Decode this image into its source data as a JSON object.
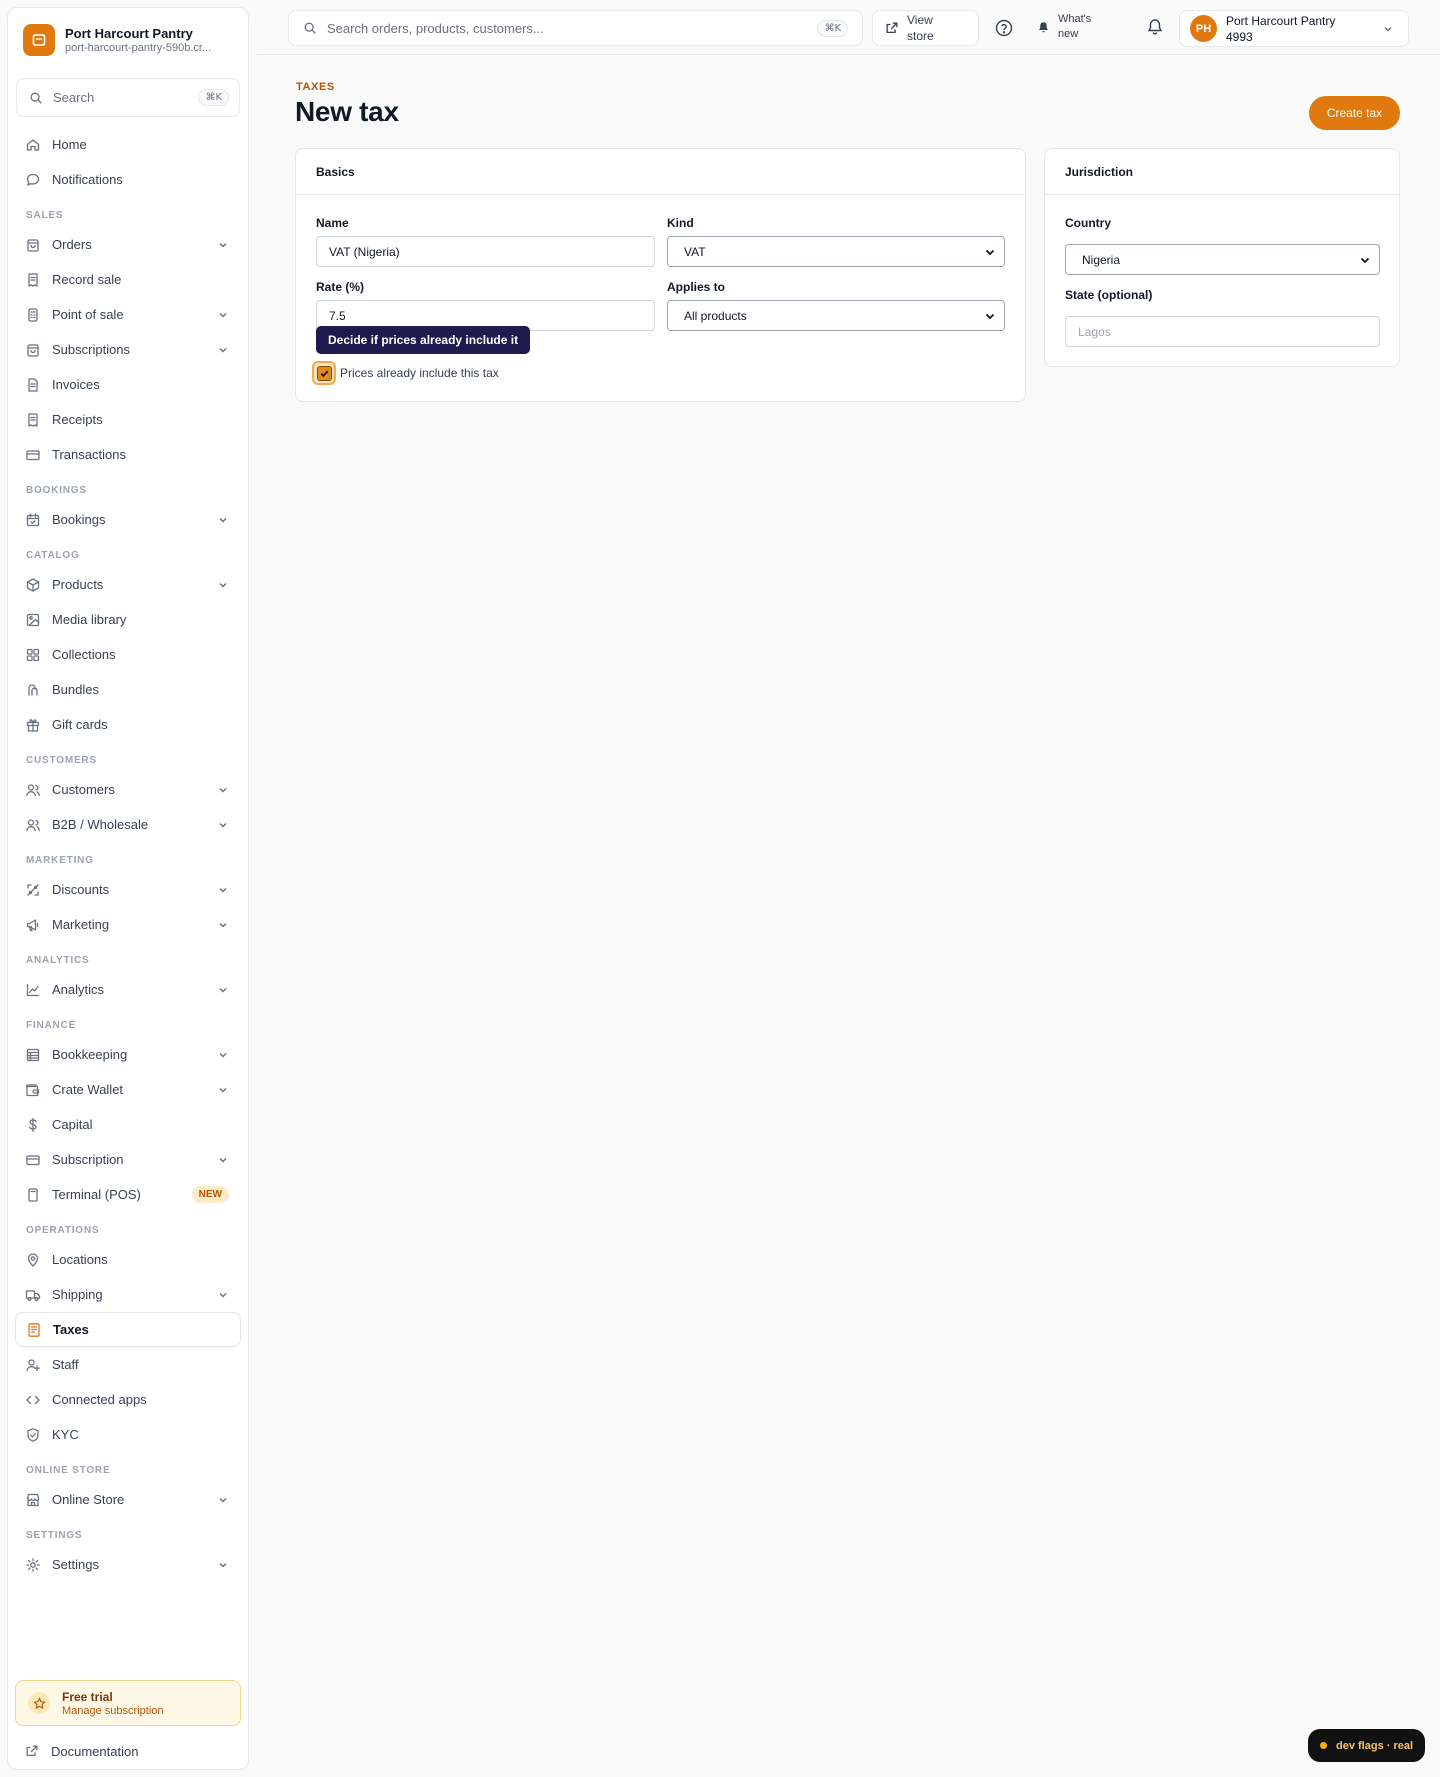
{
  "brand": {
    "name": "Port Harcourt Pantry",
    "domain": "port-harcourt-pantry-590b.cr..."
  },
  "sidebar_search": {
    "label": "Search",
    "shortcut": "⌘K"
  },
  "nav": {
    "top": [
      {
        "label": "Home",
        "icon": "home-icon"
      },
      {
        "label": "Notifications",
        "icon": "chat-bubble-icon"
      }
    ],
    "sales_label": "SALES",
    "sales": [
      {
        "label": "Orders",
        "icon": "bag-icon",
        "chevron": true
      },
      {
        "label": "Record sale",
        "icon": "receipt-icon"
      },
      {
        "label": "Point of sale",
        "icon": "pos-icon",
        "chevron": true
      },
      {
        "label": "Subscriptions",
        "icon": "bag-icon",
        "chevron": true
      },
      {
        "label": "Invoices",
        "icon": "document-icon"
      },
      {
        "label": "Receipts",
        "icon": "receipt-icon"
      },
      {
        "label": "Transactions",
        "icon": "card-icon"
      }
    ],
    "bookings_label": "BOOKINGS",
    "bookings": [
      {
        "label": "Bookings",
        "icon": "calendar-icon",
        "chevron": true
      }
    ],
    "catalog_label": "CATALOG",
    "catalog": [
      {
        "label": "Products",
        "icon": "box-icon",
        "chevron": true
      },
      {
        "label": "Media library",
        "icon": "image-icon"
      },
      {
        "label": "Collections",
        "icon": "grid-icon"
      },
      {
        "label": "Bundles",
        "icon": "bundle-icon"
      },
      {
        "label": "Gift cards",
        "icon": "gift-icon"
      }
    ],
    "customers_label": "CUSTOMERS",
    "customers": [
      {
        "label": "Customers",
        "icon": "users-icon",
        "chevron": true
      },
      {
        "label": "B2B / Wholesale",
        "icon": "users-icon",
        "chevron": true
      }
    ],
    "marketing_label": "MARKETING",
    "marketing": [
      {
        "label": "Discounts",
        "icon": "discount-icon",
        "chevron": true
      },
      {
        "label": "Marketing",
        "icon": "megaphone-icon",
        "chevron": true
      }
    ],
    "analytics_label": "ANALYTICS",
    "analytics": [
      {
        "label": "Analytics",
        "icon": "chart-icon",
        "chevron": true
      }
    ],
    "finance_label": "FINANCE",
    "finance": [
      {
        "label": "Bookkeeping",
        "icon": "ledger-icon",
        "chevron": true
      },
      {
        "label": "Crate Wallet",
        "icon": "wallet-icon",
        "chevron": true
      },
      {
        "label": "Capital",
        "icon": "dollar-icon"
      },
      {
        "label": "Subscription",
        "icon": "card-icon",
        "chevron": true
      },
      {
        "label": "Terminal (POS)",
        "icon": "terminal-icon",
        "badge": "NEW"
      }
    ],
    "operations_label": "OPERATIONS",
    "operations": [
      {
        "label": "Locations",
        "icon": "pin-icon"
      },
      {
        "label": "Shipping",
        "icon": "truck-icon",
        "chevron": true
      },
      {
        "label": "Taxes",
        "icon": "tax-document-icon",
        "active": true
      },
      {
        "label": "Staff",
        "icon": "user-plus-icon"
      },
      {
        "label": "Connected apps",
        "icon": "code-icon"
      },
      {
        "label": "KYC",
        "icon": "shield-check-icon"
      }
    ],
    "online_store_label": "ONLINE STORE",
    "online_store": [
      {
        "label": "Online Store",
        "icon": "storefront-icon",
        "chevron": true
      }
    ],
    "settings_label": "SETTINGS",
    "settings": [
      {
        "label": "Settings",
        "icon": "gear-icon",
        "chevron": true
      }
    ]
  },
  "trial": {
    "title": "Free trial",
    "subtitle": "Manage subscription"
  },
  "docs": {
    "label": "Documentation"
  },
  "topbar": {
    "search_placeholder": "Search orders, products, customers...",
    "search_shortcut": "⌘K",
    "view_store_line1": "View",
    "view_store_line2": "store",
    "whats_new_line1": "What's",
    "whats_new_line2": "new",
    "account_initials": "PH",
    "account_line1": "Port Harcourt Pantry",
    "account_line2": "4993"
  },
  "page": {
    "eyebrow": "TAXES",
    "title": "New tax",
    "create_button": "Create tax"
  },
  "basics": {
    "heading": "Basics",
    "name_label": "Name",
    "name_value": "VAT (Nigeria)",
    "kind_label": "Kind",
    "kind_value": "VAT",
    "rate_label": "Rate (%)",
    "rate_value": "7.5",
    "applies_label": "Applies to",
    "applies_value": "All products",
    "tooltip": "Decide if prices already include it",
    "checkbox_label": "Prices already include this tax",
    "checkbox_checked": true
  },
  "jurisdiction": {
    "heading": "Jurisdiction",
    "country_label": "Country",
    "country_value": "Nigeria",
    "state_label": "State (optional)",
    "state_placeholder": "Lagos"
  },
  "dev_flags": "dev flags · real",
  "colors": {
    "accent": "#e07a10",
    "tooltip_bg": "#1e1a4d"
  }
}
